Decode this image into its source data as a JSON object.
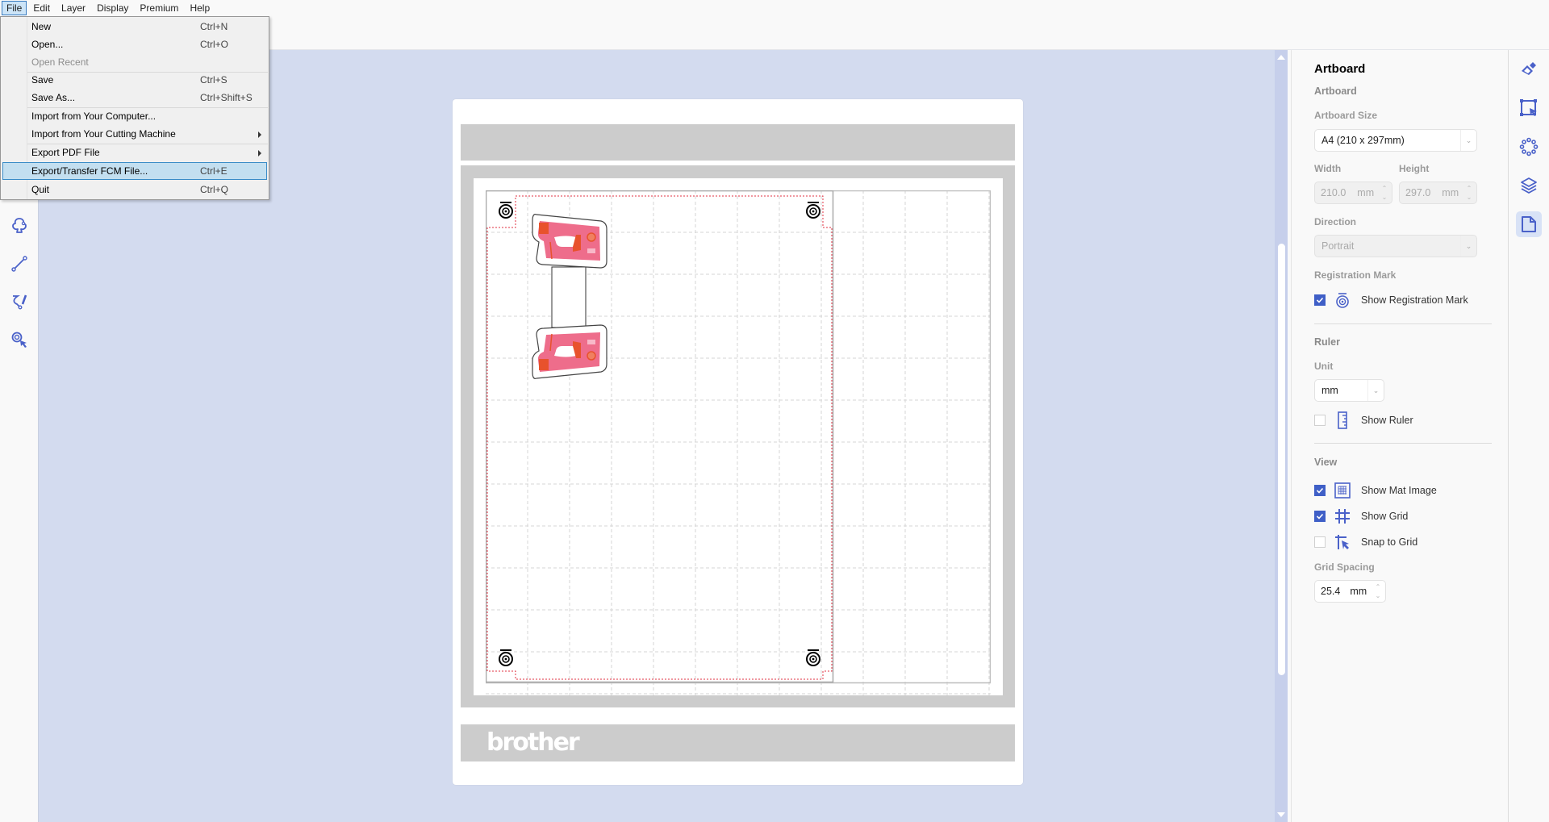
{
  "menubar": {
    "items": [
      {
        "label": "File",
        "active": true
      },
      {
        "label": "Edit"
      },
      {
        "label": "Layer"
      },
      {
        "label": "Display"
      },
      {
        "label": "Premium"
      },
      {
        "label": "Help"
      }
    ]
  },
  "file_menu": {
    "items": [
      {
        "label": "New",
        "shortcut": "Ctrl+N"
      },
      {
        "label": "Open...",
        "shortcut": "Ctrl+O"
      },
      {
        "label": "Open Recent",
        "shortcut": "",
        "disabled": true
      },
      {
        "label": "Save",
        "shortcut": "Ctrl+S"
      },
      {
        "label": "Save As...",
        "shortcut": "Ctrl+Shift+S"
      },
      {
        "label": "Import from Your Computer...",
        "shortcut": ""
      },
      {
        "label": "Import from Your Cutting Machine",
        "shortcut": "",
        "submenu": true
      },
      {
        "label": "Export PDF File",
        "shortcut": "",
        "submenu": true
      },
      {
        "label": "Export/Transfer FCM File...",
        "shortcut": "Ctrl+E",
        "highlighted": true
      },
      {
        "label": "Quit",
        "shortcut": "Ctrl+Q"
      }
    ]
  },
  "left_toolbar": {
    "tools": [
      "shape-tool",
      "line-tool",
      "freehand-tool",
      "selection-pick-tool"
    ]
  },
  "mat": {
    "brand_logo": "brother",
    "artboard_size_mm": [
      210,
      297
    ],
    "grid_spacing_mm": 25.4
  },
  "right_panel": {
    "title": "Artboard",
    "section_artboard": "Artboard",
    "artboard_size_label": "Artboard Size",
    "artboard_size_value": "A4 (210 x 297mm)",
    "width_label": "Width",
    "width_value": "210.0",
    "height_label": "Height",
    "height_value": "297.0",
    "unit_mm": "mm",
    "direction_label": "Direction",
    "direction_value": "Portrait",
    "registration_mark_label": "Registration Mark",
    "show_registration_mark": {
      "label": "Show Registration Mark",
      "checked": true
    },
    "section_ruler": "Ruler",
    "unit_label": "Unit",
    "unit_value": "mm",
    "show_ruler": {
      "label": "Show Ruler",
      "checked": false
    },
    "section_view": "View",
    "show_mat_image": {
      "label": "Show Mat Image",
      "checked": true
    },
    "show_grid": {
      "label": "Show Grid",
      "checked": true
    },
    "snap_to_grid": {
      "label": "Snap to Grid",
      "checked": false
    },
    "grid_spacing_label": "Grid Spacing",
    "grid_spacing_value": "25.4",
    "grid_spacing_unit": "mm"
  },
  "right_icons": {
    "tools": [
      "paint-brush",
      "transform-select",
      "arrange-circle",
      "layers",
      "artboard-page"
    ],
    "active": "artboard-page"
  },
  "colors": {
    "accent": "#3f5fc7",
    "canvas_bg": "#d3dbef",
    "menu_highlight": "#c3dff0",
    "cut_line": "#e03040"
  }
}
